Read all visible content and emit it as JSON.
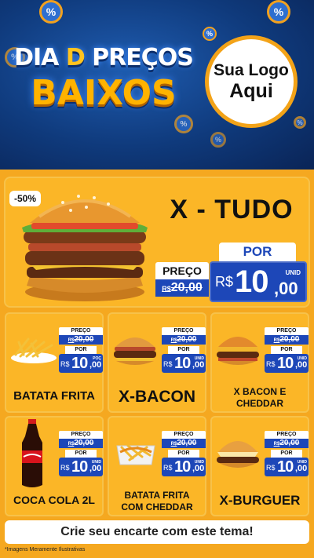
{
  "header": {
    "title_line1_a": "DIA ",
    "title_line1_b": "D",
    "title_line1_c": " PREÇOS",
    "title_line2": "BAIXOS",
    "logo_line1": "Sua Logo",
    "logo_line2": "Aqui",
    "badge_symbol": "%"
  },
  "hero": {
    "discount": "-50%",
    "name": "X - TUDO",
    "old_label": "PREÇO",
    "old_currency": "R$",
    "old_value": "20,00",
    "por_label": "POR",
    "new_currency": "R$",
    "new_int": "10",
    "new_cents": ",00",
    "unit": "UNID"
  },
  "products": [
    {
      "name": "BATATA FRITA",
      "old_label": "PREÇO",
      "old_currency": "R$",
      "old_value": "20,00",
      "por_label": "POR",
      "currency": "R$",
      "int": "10",
      "cents": ",00",
      "unit": "POÇ"
    },
    {
      "name": "X-BACON",
      "old_label": "PREÇO",
      "old_currency": "R$",
      "old_value": "20,00",
      "por_label": "POR",
      "currency": "R$",
      "int": "10",
      "cents": ",00",
      "unit": "UNID"
    },
    {
      "name_l1": "X BACON E",
      "name_l2": "CHEDDAR",
      "old_label": "PREÇO",
      "old_currency": "R$",
      "old_value": "20,00",
      "por_label": "POR",
      "currency": "R$",
      "int": "10",
      "cents": ",00",
      "unit": "UNID"
    },
    {
      "name": "COCA COLA 2L",
      "old_label": "PREÇO",
      "old_currency": "R$",
      "old_value": "20,00",
      "por_label": "POR",
      "currency": "R$",
      "int": "10",
      "cents": ",00",
      "unit": "UNID"
    },
    {
      "name_l1": "BATATA FRITA",
      "name_l2": "COM CHEDDAR",
      "old_label": "PREÇO",
      "old_currency": "R$",
      "old_value": "20,00",
      "por_label": "POR",
      "currency": "R$",
      "int": "10",
      "cents": ",00",
      "unit": "UNID"
    },
    {
      "name": "X-BURGUER",
      "old_label": "PREÇO",
      "old_currency": "R$",
      "old_value": "20,00",
      "por_label": "POR",
      "currency": "R$",
      "int": "10",
      "cents": ",00",
      "unit": "UNID"
    }
  ],
  "footer": {
    "cta": "Crie seu encarte com este tema!",
    "disclaimer": "*Imagens Meramente Ilustrativas"
  },
  "colors": {
    "orange": "#f5a820",
    "blue": "#1d47b8",
    "navy": "#0f3a7c"
  }
}
